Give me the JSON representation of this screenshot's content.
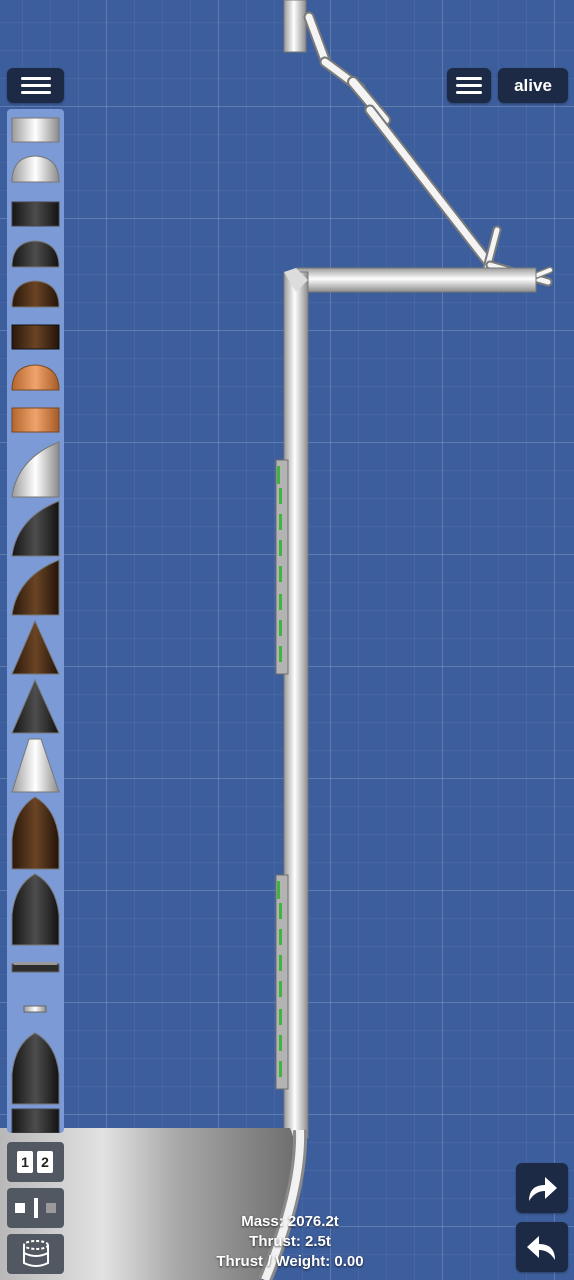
{
  "top_bar": {
    "menu_left_icon": "hamburger-icon",
    "menu_right_icon": "hamburger-icon",
    "mode_label": "alive"
  },
  "part_palette": {
    "items": [
      "fuel-tank",
      "nose-dome",
      "black-fuel-tank",
      "black-dome",
      "brown-dome",
      "brown-fuel-tank",
      "copper-dome",
      "copper-fuel-tank",
      "white-curved-nose",
      "black-curved-nose",
      "brown-curved-nose",
      "brown-cone",
      "black-cone",
      "white-cone",
      "brown-ogive-fairing",
      "black-ogive-fairing",
      "separator",
      "small-strut",
      "black-large-fairing",
      "black-tank-stub"
    ]
  },
  "bottom_tools": {
    "stage_numbers": [
      "1",
      "2"
    ],
    "symmetry_icon": "symmetry-icon",
    "fuel_icon": "fuel-tank-icon"
  },
  "stats": {
    "mass": "Mass: 2076.2t",
    "thrust": "Thrust: 2.5t",
    "thrust_weight": "Thrust / Weight: 0.00"
  },
  "actions": {
    "redo_icon": "redo-arrow-icon",
    "undo_icon": "undo-arrow-icon"
  },
  "colors": {
    "background": "#3d5e9c",
    "panel": "#1d2a45",
    "palette": "#7b9ad6",
    "accent_green": "#3fb43f"
  }
}
